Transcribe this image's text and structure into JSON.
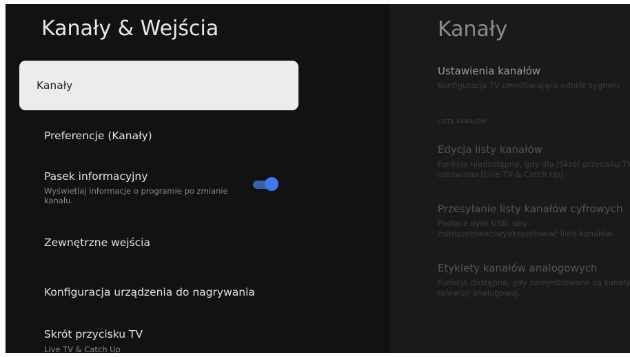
{
  "left": {
    "title": "Kanały & Wejścia",
    "items": [
      {
        "label": "Kanały"
      },
      {
        "label": "Preferencje (Kanały)"
      },
      {
        "label": "Pasek informacyjny",
        "description": "Wyświetlaj informacje o programie po zmianie kanału.",
        "toggle": "on"
      },
      {
        "label": "Zewnętrzne wejścia"
      },
      {
        "label": "Konfiguracja urządzenia do nagrywania"
      },
      {
        "label": "Skrót przycisku TV",
        "value": "Live TV & Catch Up"
      }
    ]
  },
  "right": {
    "title": "Kanały",
    "items": [
      {
        "label": "Ustawienia kanałów",
        "description": "Konfiguracja TV umożliwiająca odbiór sygnału"
      },
      {
        "label": "Edycja listy kanałów",
        "description": "Funkcja niedostępna, gdy dla [Skrót przycisku TV] ustawiono [Live TV & Catch Up]."
      },
      {
        "label": "Przesyłanie listy kanałów cyfrowych",
        "description": "Podłącz dysk USB, aby zaimportować/wyeksportować listę kanałów."
      },
      {
        "label": "Etykiety kanałów analogowych",
        "description": "Funkcja dostępna, gdy zarejestrowane są kanały telewizji analogowej."
      }
    ],
    "section_label": "LISTA KANAŁÓW"
  },
  "colors": {
    "background": "#121212",
    "selected_bg": "#ececeb",
    "toggle_on": "#3f78f0"
  }
}
